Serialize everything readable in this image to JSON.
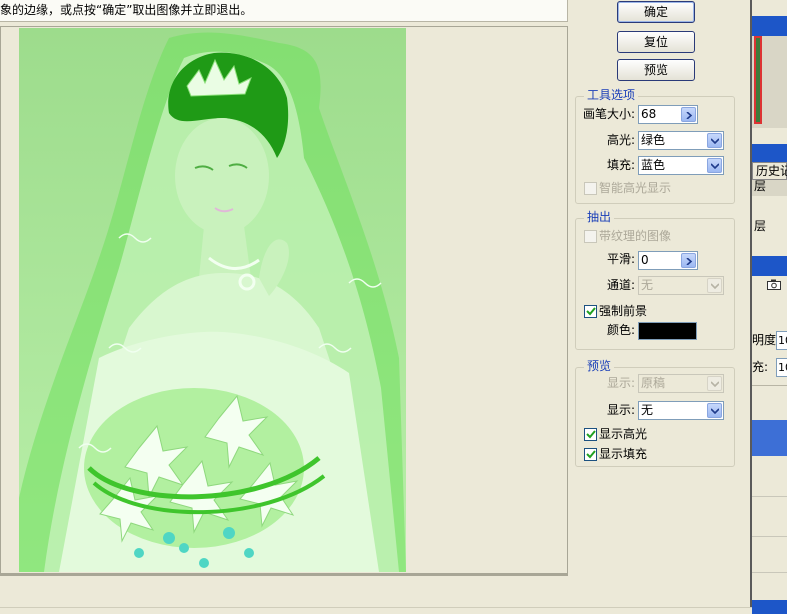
{
  "hint": {
    "text": "象的边缘，或点按“确定”取出图像并立即退出。"
  },
  "buttons": {
    "ok": "确定",
    "reset": "复位",
    "preview": "预览"
  },
  "tool_options": {
    "title": "工具选项",
    "brush_size_label": "画笔大小:",
    "brush_size_value": "68",
    "highlight_label": "高光:",
    "highlight_value": "绿色",
    "fill_label": "填充:",
    "fill_value": "蓝色",
    "smart_highlight_label": "智能高光显示"
  },
  "extraction": {
    "title": "抽出",
    "textured_label": "带纹理的图像",
    "smooth_label": "平滑:",
    "smooth_value": "0",
    "channel_label": "通道:",
    "channel_value": "无",
    "force_fg_label": "强制前景",
    "color_label": "颜色:",
    "color_value": "#000000"
  },
  "preview": {
    "title": "预览",
    "show_label_1": "显示:",
    "show_value_1": "原稿",
    "show_label_2": "显示:",
    "show_value_2": "无",
    "show_highlight_label": "显示高光",
    "show_fill_label": "显示填充"
  },
  "side_panel": {
    "history_tab": "历史记",
    "layer_1": "层",
    "layer_2": "层",
    "opacity_label": "明度:",
    "opacity_value": "10",
    "fill_label": "充:",
    "fill_value": "10"
  }
}
